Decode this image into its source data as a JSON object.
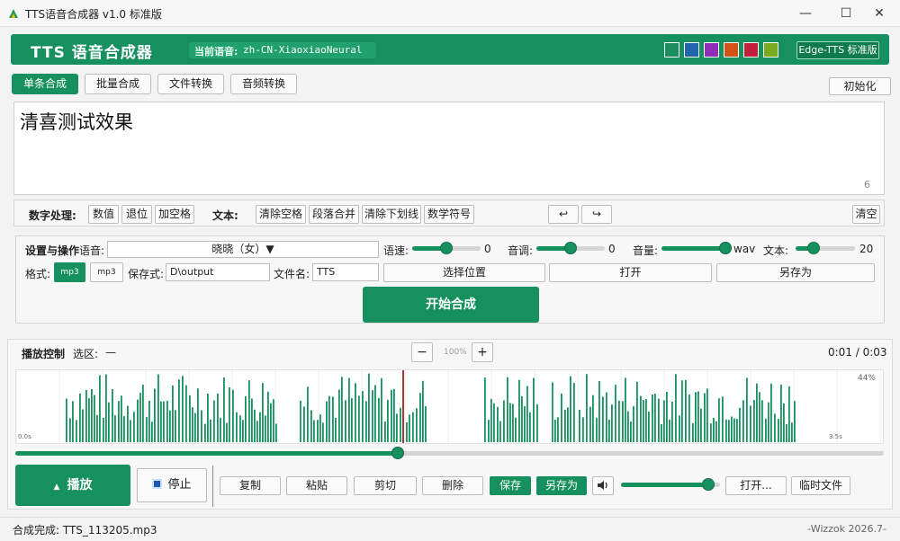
{
  "window": {
    "title": "TTS语音合成器 v1.0  标准版",
    "minimize": "—",
    "maximize": "☐",
    "close": "✕"
  },
  "header": {
    "app_title": "TTS 语音合成器",
    "voice_label": "当前语音:",
    "voice_value": "zh-CN-XiaoxiaoNeural",
    "swatches": [
      "#1a8c5e",
      "#2166ad",
      "#8f2dba",
      "#d2521a",
      "#c21f3a",
      "#7aaa22"
    ],
    "edge_button": "Edge-TTS 标准版"
  },
  "tabs": [
    {
      "label": "单条合成",
      "active": true
    },
    {
      "label": "批量合成",
      "active": false
    },
    {
      "label": "文件转换",
      "active": false
    },
    {
      "label": "音频转换",
      "active": false
    }
  ],
  "init_button": "初始化",
  "editor": {
    "text": "清喜测试效果",
    "char_count": "6"
  },
  "tools": {
    "number_label": "数字处理:",
    "number_buttons": [
      "数值",
      "退位",
      "加空格"
    ],
    "text_label": "文本:",
    "text_buttons": [
      "清除空格",
      "段落合并",
      "清除下划线",
      "数学符号"
    ],
    "undo": "↩",
    "redo": "↪",
    "clear": "清空"
  },
  "settings": {
    "section_label": "设置与操作",
    "voice_label": "语音:",
    "voice_value": "晓晓（女）▼",
    "speed_label": "语速:",
    "speed_value": "0",
    "speed_level": 0.5,
    "pitch_label": "音调:",
    "pitch_value": "0",
    "pitch_level": 0.5,
    "volume_label": "音量:",
    "volume_value": "wav",
    "volume_level": 1.0,
    "textsize_label": "文本:",
    "textsize_value": "20",
    "textsize_level": 0.3,
    "format_label": "格式:",
    "format_options": [
      "mp3",
      "mp3"
    ],
    "save_path_label": "保存式:",
    "save_path_value": "D\\output",
    "filename_label": "文件名:",
    "filename_value": "TTS",
    "choose_location": "选择位置",
    "open": "打开",
    "save_as": "另存为",
    "start": "开始合成"
  },
  "playback": {
    "label": "播放控制",
    "selection_label": "选区:",
    "selection_value": "—",
    "zoom_minus": "−",
    "zoom_value": "100%",
    "zoom_plus": "+",
    "time": "0:01 / 0:03",
    "wave_percent": "44%",
    "wave_start": "0.0s",
    "wave_end": "3.5s",
    "progress_level": 0.44,
    "play": "播放",
    "stop": "停止",
    "edit_buttons": [
      "复制",
      "粘贴",
      "剪切",
      "删除"
    ],
    "save": "保存",
    "save_as": "另存为",
    "volume_level": 0.88,
    "open_file": "打开...",
    "temp_file": "临时文件"
  },
  "status": {
    "left": "合成完成: TTS_113205.mp3",
    "right": "-Wizzok 2026.7-"
  }
}
